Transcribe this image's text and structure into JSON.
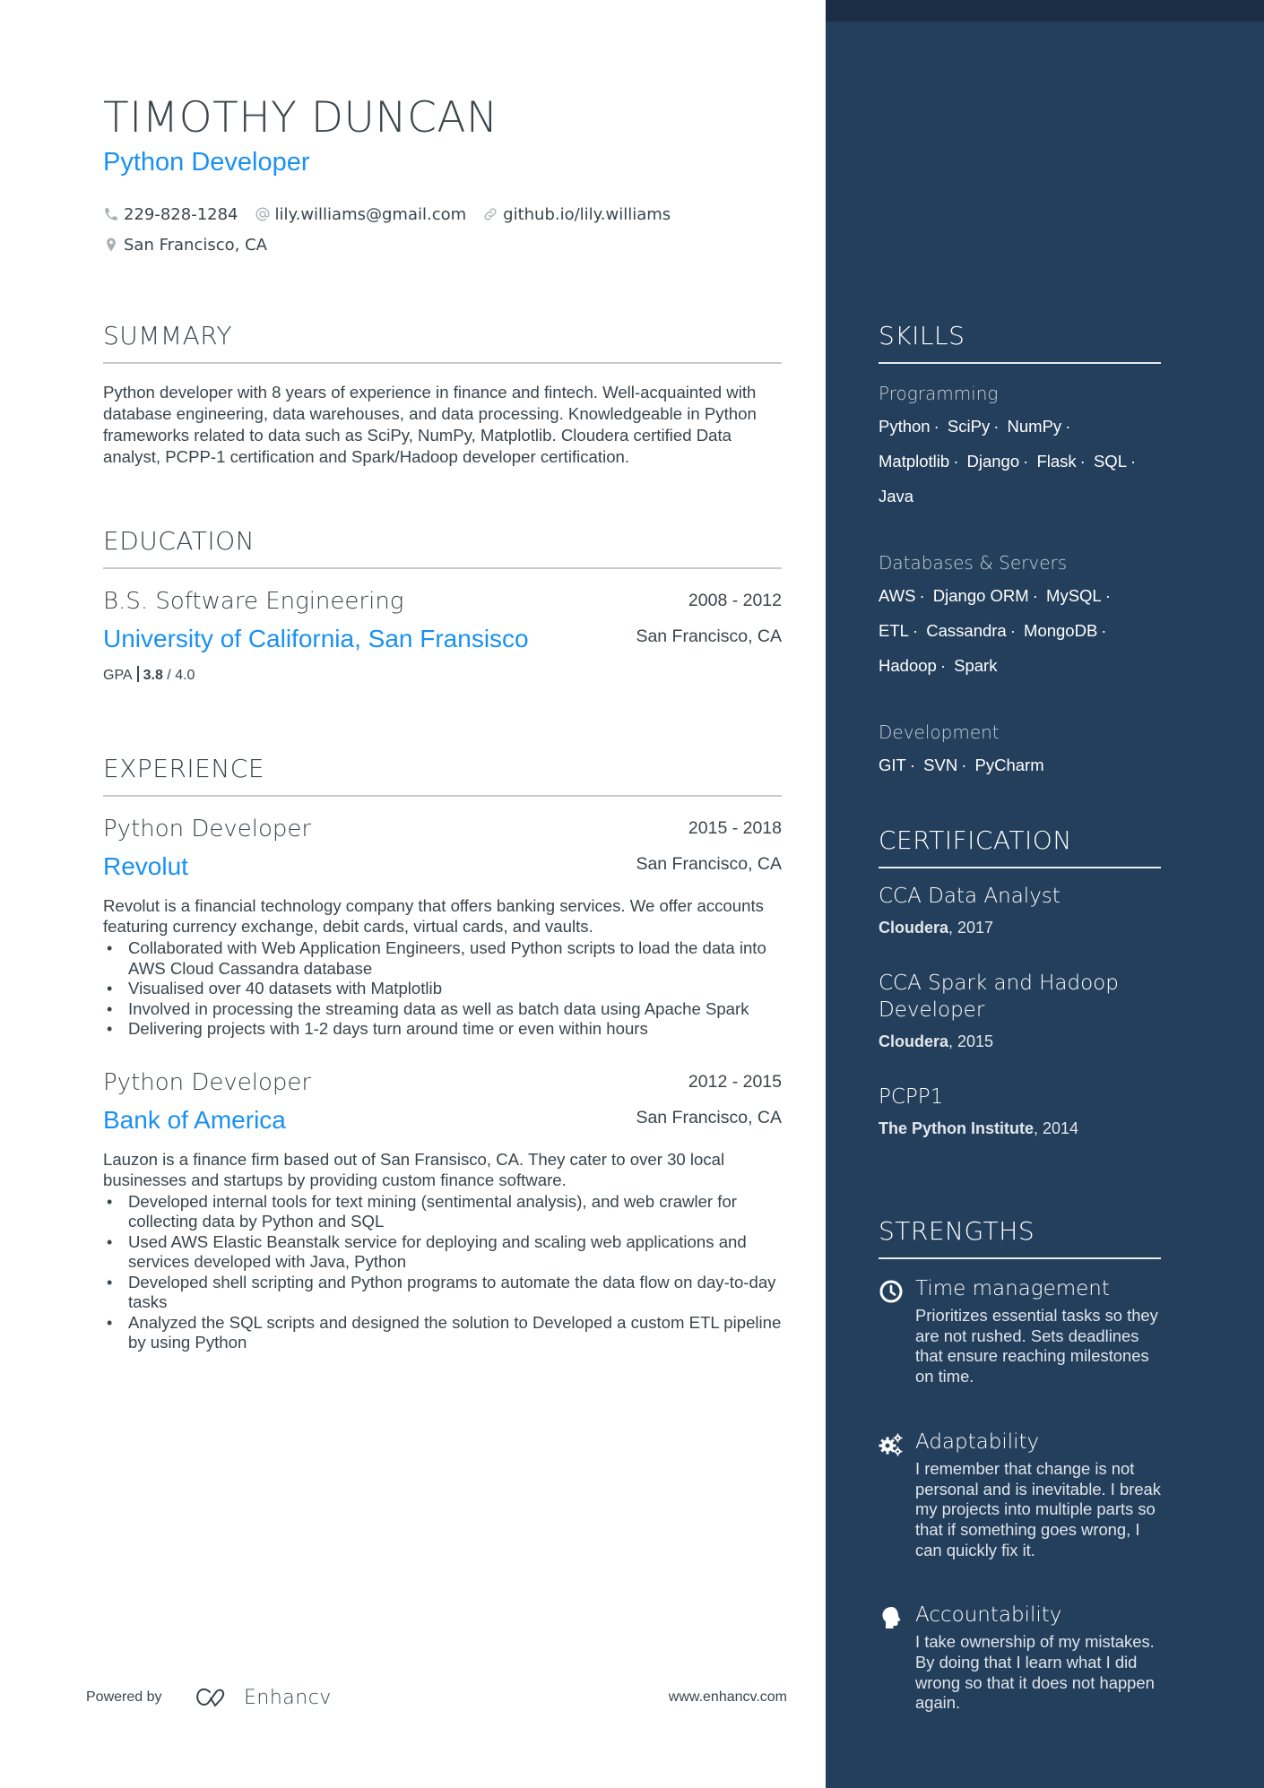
{
  "header": {
    "name": "TIMOTHY DUNCAN",
    "role": "Python Developer",
    "contacts": {
      "phone": {
        "icon": "phone-icon",
        "value": "229-828-1284"
      },
      "email": {
        "icon": "at-icon",
        "value": "lily.williams@gmail.com"
      },
      "website": {
        "icon": "link-icon",
        "value": "github.io/lily.williams"
      },
      "location": {
        "icon": "location-pin-icon",
        "value": "San Francisco, CA"
      }
    }
  },
  "summary": {
    "title": "SUMMARY",
    "text": "Python developer with 8 years of experience in finance and fintech. Well-acquainted with database engineering, data warehouses, and data processing. Knowledgeable in Python frameworks related to data such as SciPy, NumPy, Matplotlib. Cloudera certified Data analyst, PCPP-1 certification and Spark/Hadoop developer certification."
  },
  "education": {
    "title": "EDUCATION",
    "items": [
      {
        "degree": "B.S. Software Engineering",
        "school": "University of California, San Fransisco",
        "dates": "2008 - 2012",
        "location": "San Francisco, CA",
        "gpa_label": "GPA",
        "gpa_value": "3.8",
        "gpa_max": " / 4.0"
      }
    ]
  },
  "experience": {
    "title": "EXPERIENCE",
    "items": [
      {
        "role": "Python Developer",
        "company": "Revolut",
        "dates": "2015 - 2018",
        "location": "San Francisco, CA",
        "description": "Revolut is a financial technology company that offers banking services. We offer accounts featuring currency exchange, debit cards, virtual cards, and vaults.",
        "bullets": [
          "Collaborated with Web Application Engineers, used Python scripts to load the data into AWS Cloud Cassandra database",
          "Visualised over 40 datasets with Matplotlib",
          "Involved in processing the streaming data as well as batch data using Apache Spark",
          "Delivering projects with 1-2 days turn around time or even within hours"
        ]
      },
      {
        "role": "Python Developer",
        "company": "Bank of America",
        "dates": "2012 - 2015",
        "location": "San Francisco, CA",
        "description": "Lauzon is a finance firm based out of San Fransisco, CA. They cater to over 30 local businesses and startups by providing custom finance software.",
        "bullets": [
          "Developed internal tools for text mining (sentimental analysis), and web crawler for collecting data by Python and SQL",
          "Used AWS Elastic Beanstalk service for deploying and scaling web applications and services developed with Java, Python",
          "Developed shell scripting and Python programs to automate the data flow on day-to-day tasks",
          "Analyzed the SQL scripts and designed the solution to Developed a custom ETL pipeline by using Python"
        ]
      }
    ]
  },
  "footer": {
    "powered_by": "Powered by",
    "brand": "Enhancv",
    "website": "www.enhancv.com"
  },
  "skills": {
    "title": "SKILLS",
    "groups": [
      {
        "label": "Programming",
        "items": [
          "Python",
          "SciPy",
          "NumPy",
          "Matplotlib",
          "Django",
          "Flask",
          "SQL",
          "Java"
        ]
      },
      {
        "label": "Databases & Servers",
        "items": [
          "AWS",
          "Django ORM",
          "MySQL",
          "ETL",
          "Cassandra",
          "MongoDB",
          "Hadoop",
          "Spark"
        ]
      },
      {
        "label": "Development",
        "items": [
          "GIT",
          "SVN",
          "PyCharm"
        ]
      }
    ]
  },
  "certification": {
    "title": "CERTIFICATION",
    "items": [
      {
        "name": "CCA Data Analyst",
        "issuer": "Cloudera",
        "year": ", 2017"
      },
      {
        "name": "CCA Spark and Hadoop Developer",
        "issuer": "Cloudera",
        "year": ", 2015"
      },
      {
        "name": "PCPP1",
        "issuer": "The Python Institute",
        "year": ", 2014"
      }
    ]
  },
  "strengths": {
    "title": "STRENGTHS",
    "items": [
      {
        "icon": "clock-icon",
        "title": "Time management",
        "description": "Prioritizes essential tasks so they are not rushed. Sets deadlines that ensure reaching milestones on time."
      },
      {
        "icon": "gears-icon",
        "title": "Adaptability",
        "description": "I remember that change is not personal and is inevitable. I break my projects into multiple parts so that if something goes wrong, I can quickly fix it."
      },
      {
        "icon": "head-icon",
        "title": "Accountability",
        "description": "I take ownership of my mistakes. By doing that I learn what I did wrong so that it does not happen again."
      }
    ]
  },
  "colors": {
    "accent": "#1a91f0",
    "text": "#3a454b",
    "sidebar_bg": "#243f5c",
    "sidebar_band": "#1b2d45"
  }
}
